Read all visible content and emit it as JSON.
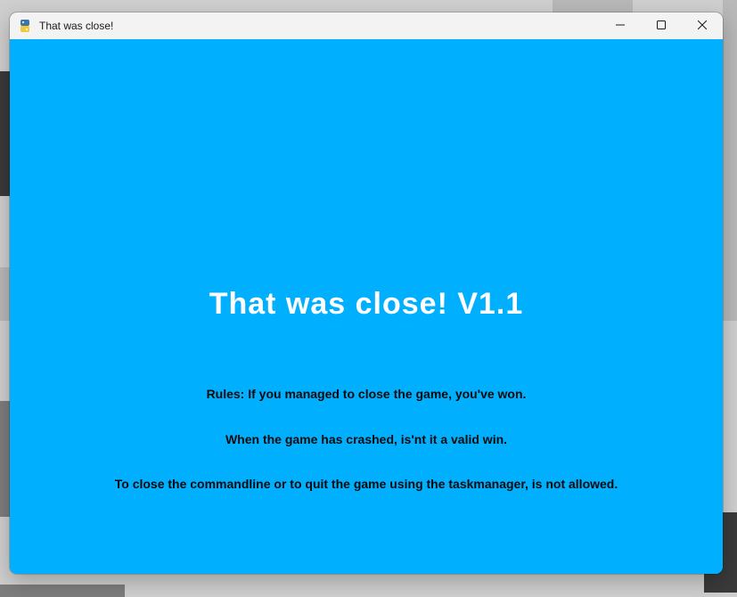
{
  "window": {
    "title": "That was close!",
    "app_icon": "python-icon",
    "controls": [
      "minimize-icon",
      "maximize-icon",
      "close-icon"
    ]
  },
  "game": {
    "title": "That was close! V1.1",
    "rules": [
      "Rules: If you managed to close the game, you've won.",
      "When the game has crashed, is'nt it a valid win.",
      "To close the commandline or to quit the game using the taskmanager, is not allowed."
    ]
  },
  "colors": {
    "background": "#00b0ff",
    "title_text": "#ffffff",
    "rule_text": "#0a0a0a",
    "titlebar": "#f3f3f3"
  }
}
